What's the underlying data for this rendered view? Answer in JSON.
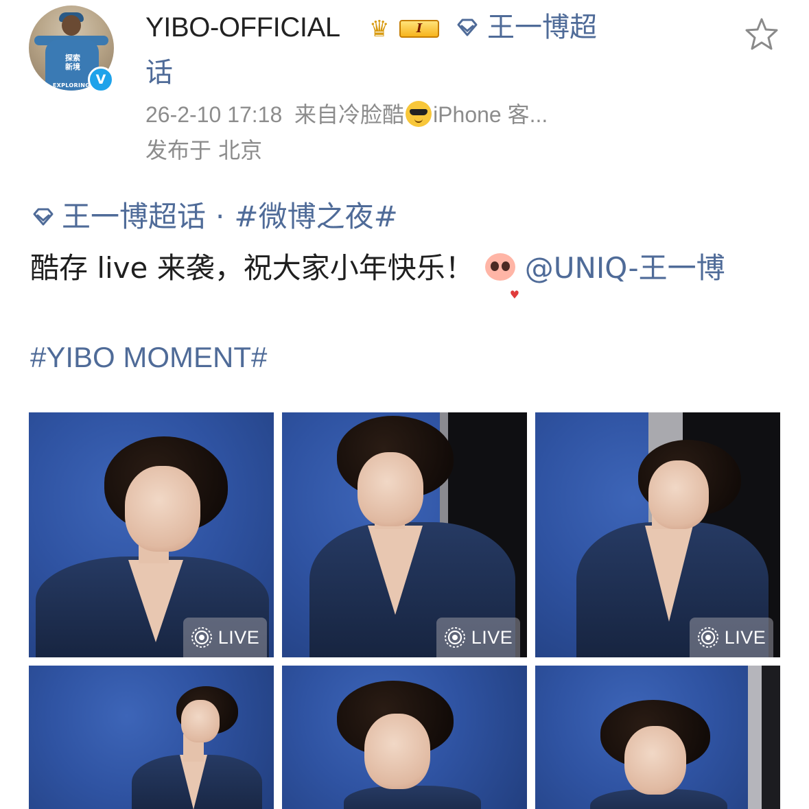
{
  "header": {
    "username": "YIBO-OFFICIAL",
    "rank_badge": "I",
    "topic_line1": "王一博超",
    "topic_line2": "话",
    "timestamp": "26-2-10 17:18",
    "source_prefix": "来自冷脸酷",
    "source_suffix": "iPhone 客...",
    "location": "发布于  北京",
    "avatar_text": "探索\n新境",
    "avatar_subtext": "EXPLORING",
    "verified_mark": "V"
  },
  "post": {
    "topic": "王一博超话",
    "separator": "·",
    "hashtag1": "#微博之夜#",
    "text": "酷存 live 来袭，祝大家小年快乐！",
    "mention": "@UNIQ-王一博",
    "hashtag2": "#YIBO MOMENT#"
  },
  "photos": [
    {
      "live": "LIVE"
    },
    {
      "live": "LIVE"
    },
    {
      "live": "LIVE"
    },
    {
      "live": ""
    },
    {
      "live": ""
    },
    {
      "live": ""
    }
  ],
  "colors": {
    "link": "#4f6b98",
    "meta": "#8c8c8c",
    "verified": "#1ea2ea",
    "backdrop": "#2f53a2"
  },
  "icons": [
    "diamond-icon",
    "crown-icon",
    "star-icon",
    "sunglasses-emoji-icon",
    "sticker-icon",
    "live-icon",
    "verified-icon"
  ]
}
